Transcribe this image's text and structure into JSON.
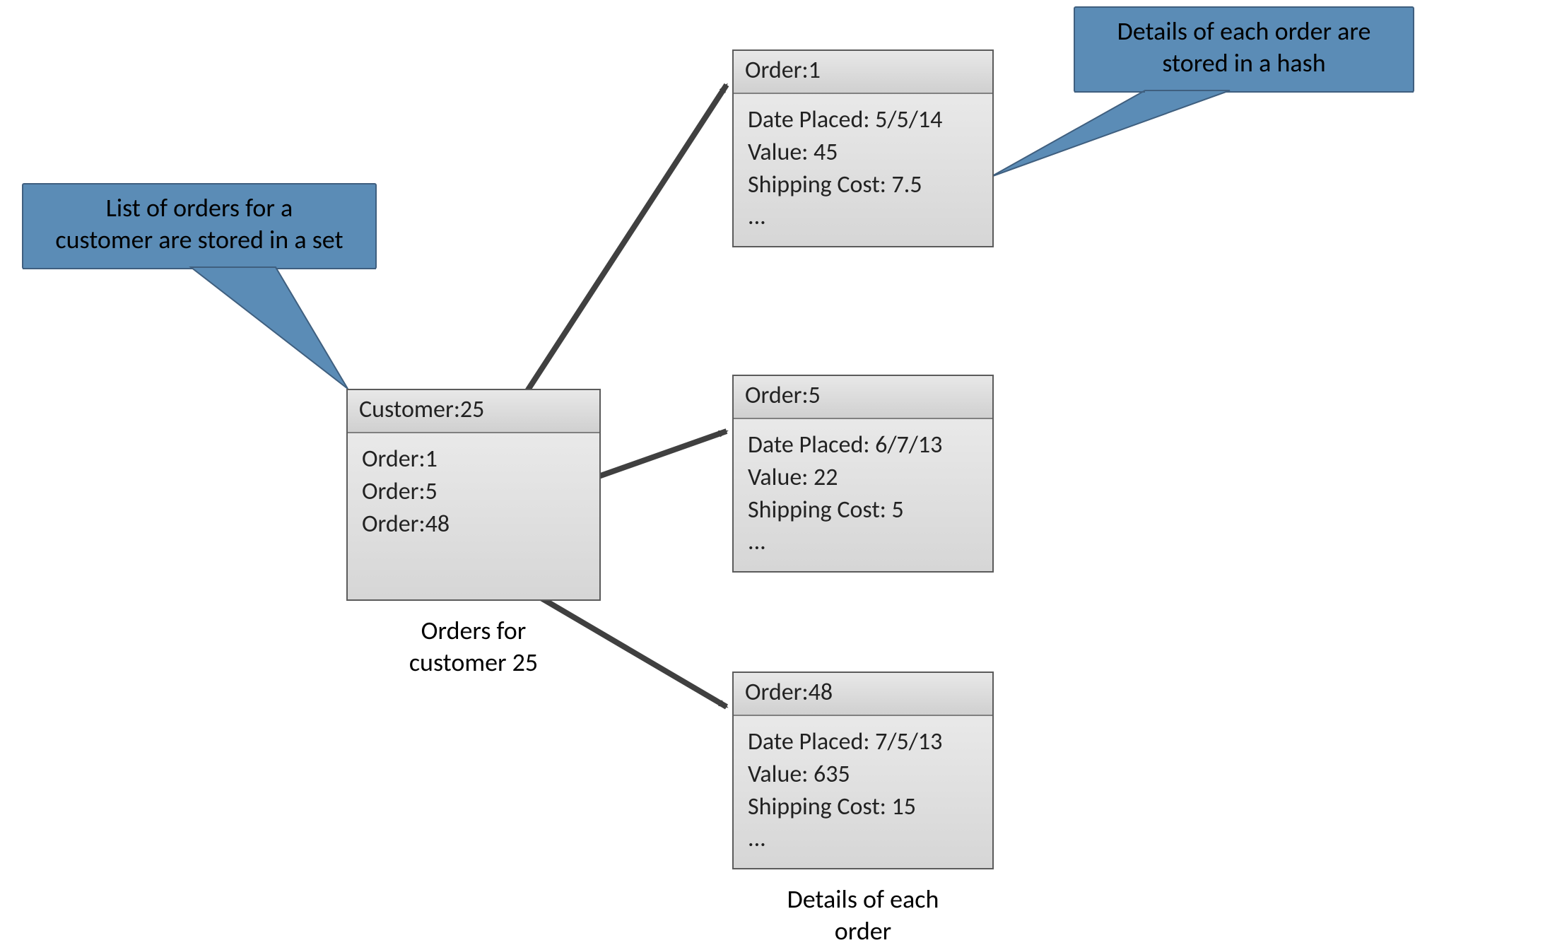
{
  "callouts": {
    "left": {
      "line1": "List of orders for a",
      "line2": "customer are stored in a set"
    },
    "right": {
      "line1": "Details of each order are",
      "line2": "stored in a hash"
    }
  },
  "customer_set": {
    "header": "Customer:25",
    "items": [
      "Order:1",
      "Order:5",
      "Order:48"
    ],
    "caption_line1": "Orders for",
    "caption_line2": "customer 25"
  },
  "orders": [
    {
      "header": "Order:1",
      "lines": [
        "Date Placed: 5/5/14",
        "Value: 45",
        "Shipping Cost: 7.5",
        "..."
      ]
    },
    {
      "header": "Order:5",
      "lines": [
        "Date Placed: 6/7/13",
        "Value: 22",
        "Shipping Cost: 5",
        "..."
      ]
    },
    {
      "header": "Order:48",
      "lines": [
        "Date Placed: 7/5/13",
        "Value: 635",
        "Shipping Cost: 15",
        "..."
      ]
    }
  ],
  "orders_caption_line1": "Details of each",
  "orders_caption_line2": "order",
  "colors": {
    "callout_fill": "#5b8cb6",
    "callout_stroke": "#3f5f7f",
    "box_border": "#5b5b5b",
    "arrow": "#404040"
  }
}
